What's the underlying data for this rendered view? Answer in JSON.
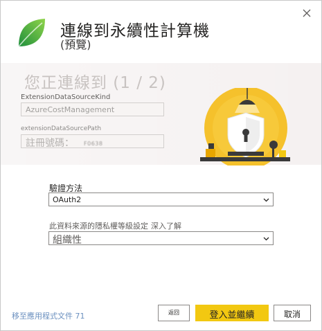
{
  "dialog": {
    "title": "連線到永續性計算機",
    "subtitle": "(預覽)",
    "close_icon": "close-icon"
  },
  "step": {
    "heading": "您正連線到 (1 / 2)",
    "field1_label": "ExtensionDataSourceKind",
    "field1_value": "AzureCostManagement",
    "field2_label": "extensionDataSourcePath",
    "field2_value": "註冊號碼：",
    "field2_redacted": "F0638"
  },
  "form": {
    "auth_label": "驗證方法",
    "auth_value": "OAuth2",
    "privacy_label": "此資料來源的隱私權等級設定",
    "privacy_link": "深入了解",
    "privacy_value": "組織性"
  },
  "footer": {
    "docs_link": "移至應用程式文件 71",
    "back_label": "返回",
    "signin_label": "登入並繼續",
    "cancel_label": "取消"
  },
  "colors": {
    "accent_primary": "#f2c811",
    "link": "#6a8fbf",
    "logo_green": "#2aa84a",
    "band": "#f3efee"
  }
}
